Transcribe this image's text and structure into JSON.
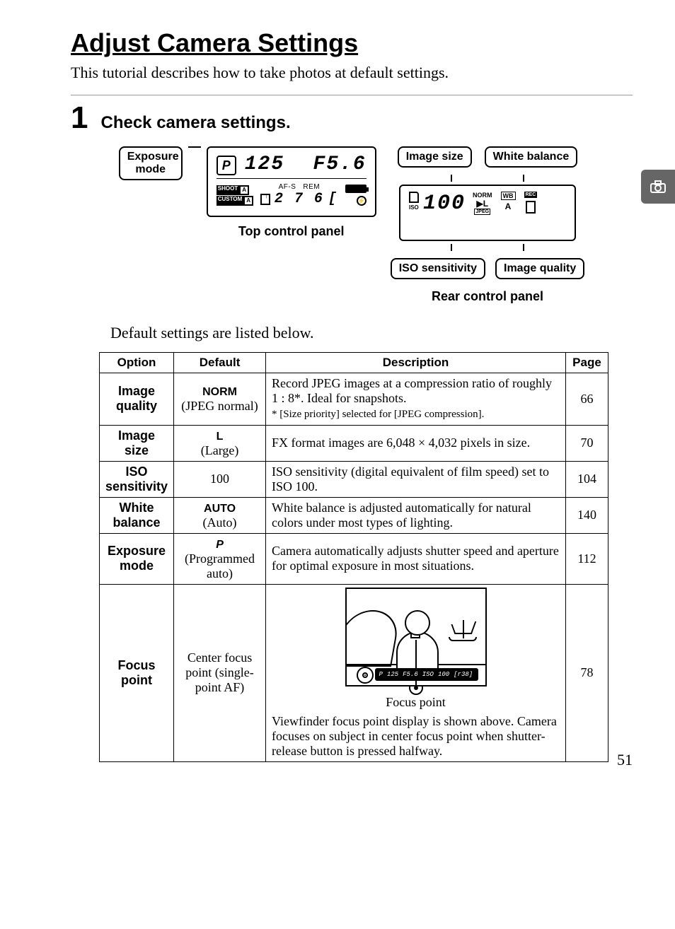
{
  "title": "Adjust Camera Settings",
  "intro": "This tutorial describes how to take photos at default settings.",
  "step": {
    "number": "1",
    "heading": "Check camera settings."
  },
  "top_panel": {
    "label_chip": "Exposure mode",
    "p_mode": "P",
    "shutter": "125",
    "aperture": "F5.6",
    "af_mode": "AF-S",
    "rem_label": "REM",
    "shoot": "SHOOT",
    "shoot_suffix": "A",
    "custom": "CUSTOM",
    "custom_suffix": "A",
    "frames_remaining": "2 7 6",
    "bracket_spacer": "[",
    "caption": "Top control panel"
  },
  "rear_panel": {
    "label_image_size": "Image size",
    "label_white_balance": "White balance",
    "label_iso": "ISO sensitivity",
    "label_quality": "Image quality",
    "iso_small": "ISO",
    "iso_value": "100",
    "norm": "NORM",
    "jpeg": "JPEG",
    "wb": "WB",
    "wb_mode": "A",
    "rec": "REC",
    "caption": "Rear control panel"
  },
  "default_note": "Default settings are listed below.",
  "table_headers": {
    "option": "Option",
    "default": "Default",
    "description": "Description",
    "page": "Page"
  },
  "rows": [
    {
      "option": "Image quality",
      "default_strong": "NORM",
      "default_sub": "(JPEG normal)",
      "description": "Record JPEG images at a compression ratio of roughly 1 : 8*. Ideal for snapshots.",
      "foot": "* [Size priority] selected for [JPEG compression].",
      "page": "66"
    },
    {
      "option": "Image size",
      "default_strong": "L",
      "default_sub": "(Large)",
      "description": "FX format images are 6,048 × 4,032 pixels in size.",
      "page": "70"
    },
    {
      "option": "ISO sensitivity",
      "default_strong": "",
      "default_sub": "100",
      "description": "ISO sensitivity (digital equivalent of film speed) set to ISO 100.",
      "page": "104"
    },
    {
      "option": "White balance",
      "default_strong": "AUTO",
      "default_sub": "(Auto)",
      "description": "White balance is adjusted automatically for natural colors under most types of lighting.",
      "page": "140"
    },
    {
      "option": "Exposure mode",
      "default_strong": "P",
      "default_sub": "(Programmed auto)",
      "description": "Camera automatically adjusts shutter speed and aperture for optimal exposure in most situations.",
      "page": "112"
    },
    {
      "option": "Focus point",
      "default_strong": "",
      "default_sub": "Center focus point (single-point AF)",
      "vf_caption": "Focus point",
      "vf_strip": {
        "p": "P",
        "shutter": "125",
        "ap": "F5.6",
        "iso": "ISO",
        "isoval": "100",
        "frames": "[r38]"
      },
      "description": "Viewfinder focus point display is shown above.  Camera focuses on subject in center focus point when shutter-release button is pressed halfway.",
      "page": "78"
    }
  ],
  "page_number": "51"
}
